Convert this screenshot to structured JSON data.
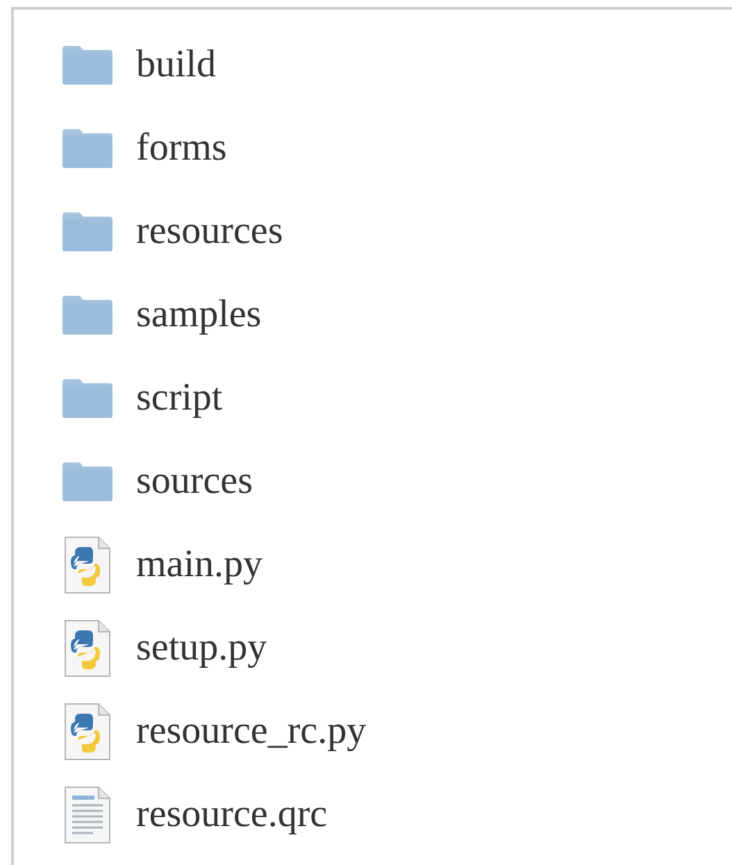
{
  "files": [
    {
      "name": "build",
      "kind": "folder"
    },
    {
      "name": "forms",
      "kind": "folder"
    },
    {
      "name": "resources",
      "kind": "folder"
    },
    {
      "name": "samples",
      "kind": "folder"
    },
    {
      "name": "script",
      "kind": "folder"
    },
    {
      "name": "sources",
      "kind": "folder"
    },
    {
      "name": "main.py",
      "kind": "python"
    },
    {
      "name": "setup.py",
      "kind": "python"
    },
    {
      "name": "resource_rc.py",
      "kind": "python"
    },
    {
      "name": "resource.qrc",
      "kind": "text"
    }
  ]
}
